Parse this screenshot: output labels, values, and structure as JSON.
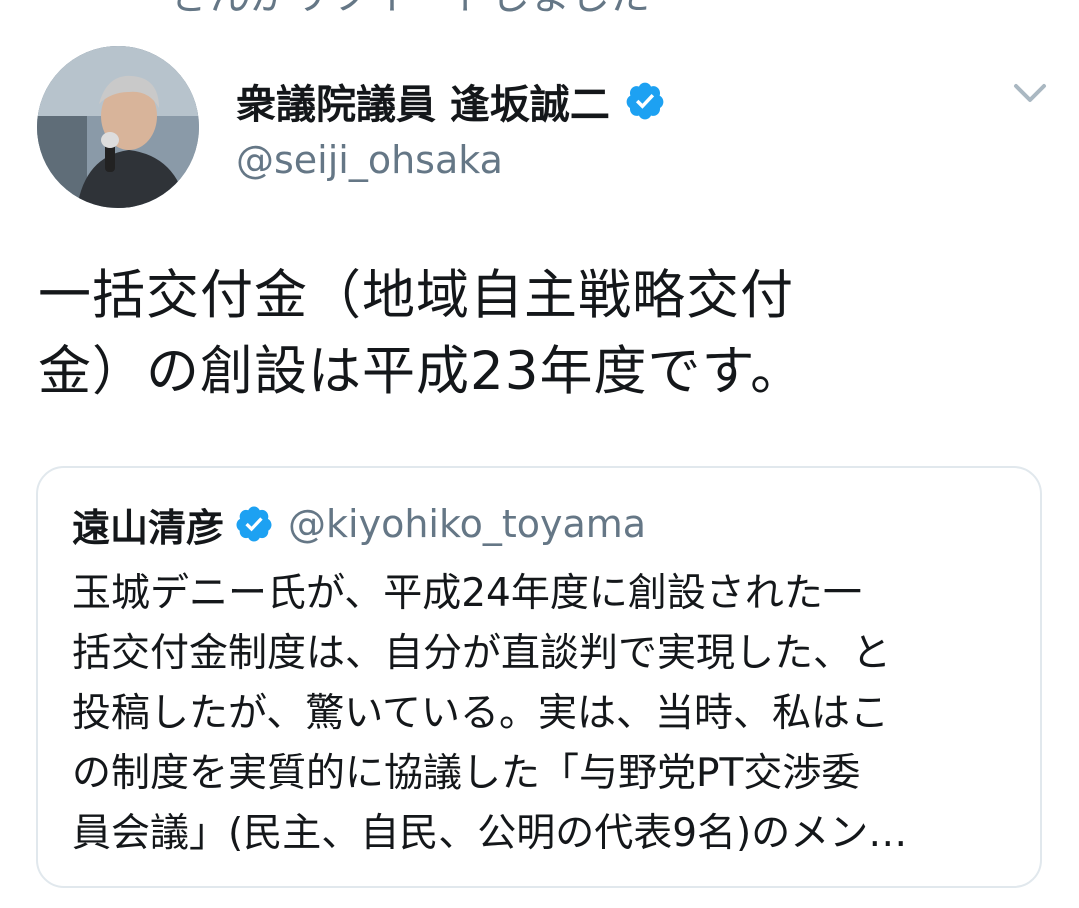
{
  "retweet_context": "さんがリツイートしました",
  "tweet": {
    "author": {
      "display_name": "衆議院議員 逢坂誠二",
      "handle": "@seiji_ohsaka",
      "verified": true
    },
    "text": "一括交付金（地域自主戦略交付\n金）の創設は平成23年度です。"
  },
  "quoted_tweet": {
    "author": {
      "display_name": "遠山清彦",
      "handle": "@kiyohiko_toyama",
      "verified": true
    },
    "text": "玉城デニー氏が、平成24年度に創設された一\n括交付金制度は、自分が直談判で実現した、と\n投稿したが、驚いている。実は、当時、私はこ\nの制度を実質的に協議した「与野党PT交渉委\n員会議」(民主、自民、公明の代表9名)のメン…"
  },
  "icons": {
    "verified": "verified-badge-icon",
    "caret": "chevron-down-icon",
    "avatar": "profile-photo"
  },
  "colors": {
    "verified_blue": "#1da1f2",
    "secondary_text": "#657786",
    "border": "#e1e8ed"
  }
}
